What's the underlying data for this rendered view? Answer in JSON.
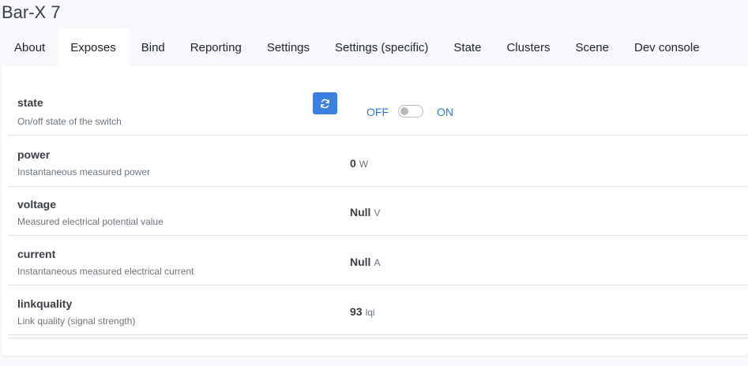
{
  "device_title": "Bar-X 7",
  "tabs": [
    {
      "label": "About"
    },
    {
      "label": "Exposes"
    },
    {
      "label": "Bind"
    },
    {
      "label": "Reporting"
    },
    {
      "label": "Settings"
    },
    {
      "label": "Settings (specific)"
    },
    {
      "label": "State"
    },
    {
      "label": "Clusters"
    },
    {
      "label": "Scene"
    },
    {
      "label": "Dev console"
    }
  ],
  "active_tab": "Exposes",
  "state_row": {
    "name": "state",
    "description": "On/off state of the switch",
    "refresh_icon": "refresh-icon",
    "off_label": "OFF",
    "on_label": "ON",
    "toggle_on": false
  },
  "rows": [
    {
      "name": "power",
      "description": "Instantaneous measured power",
      "value": "0",
      "unit": "W"
    },
    {
      "name": "voltage",
      "description": "Measured electrical potential value",
      "value": "Null",
      "unit": "V"
    },
    {
      "name": "current",
      "description": "Instantaneous measured electrical current",
      "value": "Null",
      "unit": "A"
    },
    {
      "name": "linkquality",
      "description": "Link quality (signal strength)",
      "value": "93",
      "unit": "lqi"
    }
  ],
  "colors": {
    "accent": "#3d7fe0",
    "link_text": "#2f7ad8"
  }
}
